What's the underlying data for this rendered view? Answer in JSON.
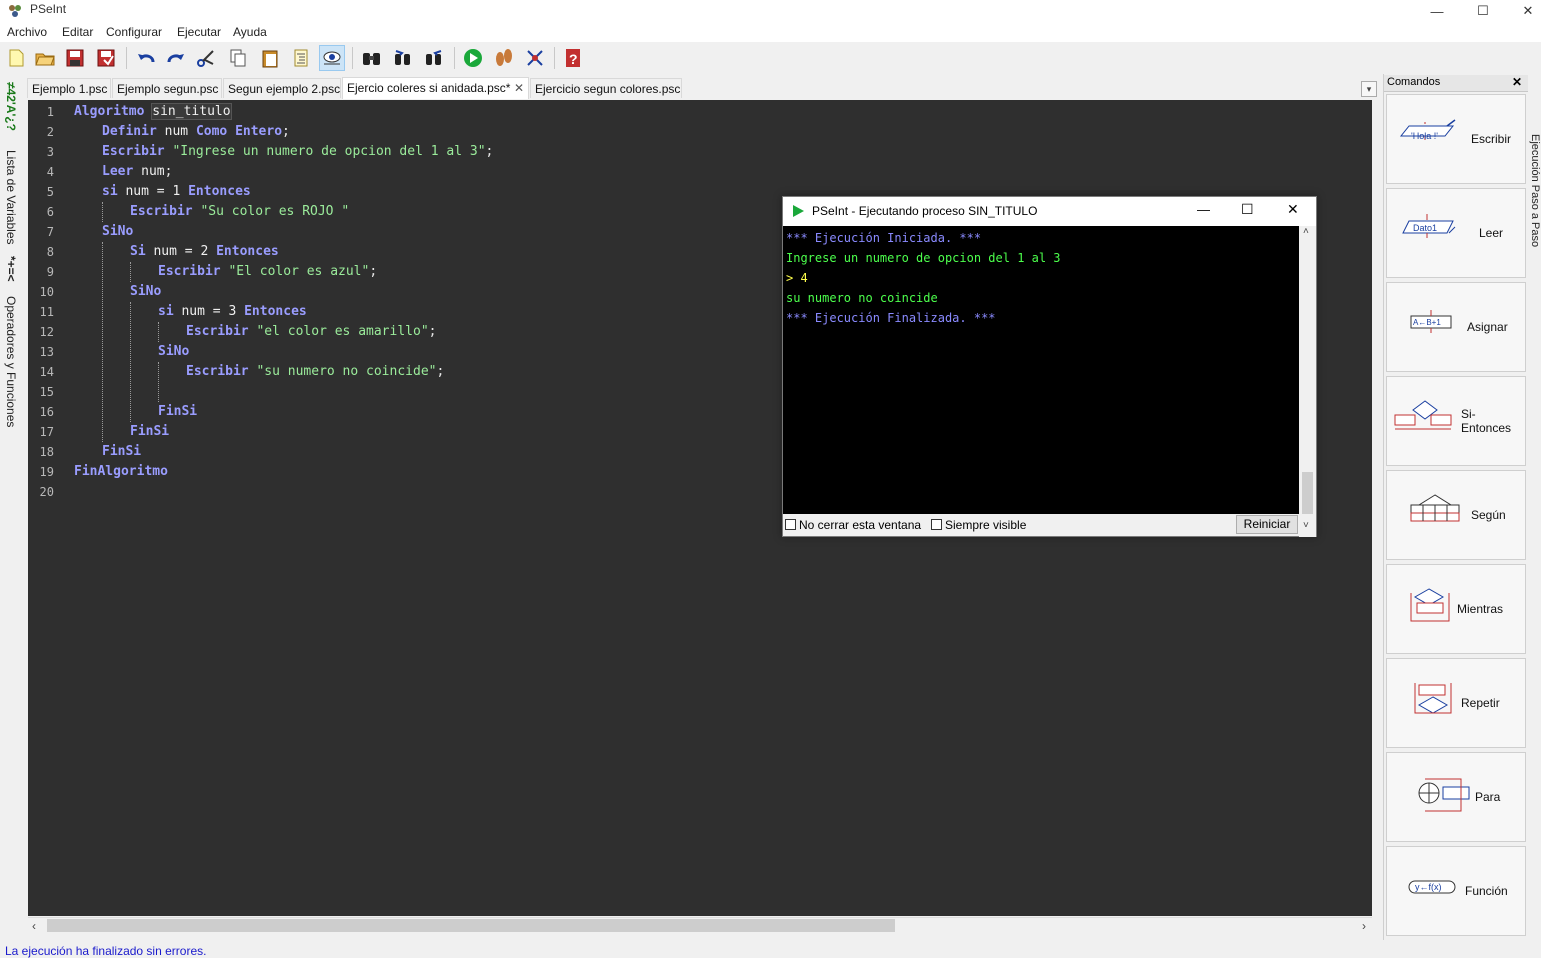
{
  "window": {
    "title": "PSeInt",
    "minimize": "—",
    "maximize": "☐",
    "close": "✕"
  },
  "menu": [
    "Archivo",
    "Editar",
    "Configurar",
    "Ejecutar",
    "Ayuda"
  ],
  "toolbar_icons": [
    "new-file-icon",
    "open-folder-icon",
    "save-icon",
    "save-as-icon",
    "undo-icon",
    "redo-icon",
    "cut-icon",
    "copy-icon",
    "paste-icon",
    "indent-icon",
    "variables-eye-icon",
    "find-icon",
    "find-prev-icon",
    "find-next-icon",
    "run-icon",
    "step-by-step-icon",
    "flowchart-icon",
    "help-icon"
  ],
  "left_panel": {
    "variables_label": "Lista de Variables",
    "operators_label": "Operadores y Funciones",
    "variables_glyph": "≠42'A'¿?",
    "operators_glyph": "*+=<"
  },
  "tabs": [
    {
      "label": "Ejemplo 1.psc"
    },
    {
      "label": "Ejemplo segun.psc"
    },
    {
      "label": "Segun ejemplo 2.psc"
    },
    {
      "label": "Ejercio coleres si anidada.psc*",
      "close": "✕"
    },
    {
      "label": "Ejercicio segun colores.psc"
    }
  ],
  "editor": {
    "line_numbers": [
      "1",
      "2",
      "3",
      "4",
      "5",
      "6",
      "7",
      "8",
      "9",
      "10",
      "11",
      "12",
      "13",
      "14",
      "15",
      "16",
      "17",
      "18",
      "19",
      "20"
    ],
    "lines": {
      "l1": {
        "kw": "Algoritmo",
        "id": "sin_titulo"
      },
      "l2": {
        "kw1": "Definir",
        "id": "num",
        "kw2": "Como",
        "kw3": "Entero",
        "end": ";"
      },
      "l3": {
        "kw": "Escribir",
        "str": "\"Ingrese un numero de opcion del 1 al 3\"",
        "end": ";"
      },
      "l4": {
        "kw": "Leer",
        "id": "num",
        "end": ";"
      },
      "l5": {
        "kw1": "si",
        "id": "num = 1",
        "kw2": "Entonces"
      },
      "l6": {
        "kw": "Escribir",
        "str": "\"Su color es ROJO \""
      },
      "l7": {
        "kw": "SiNo"
      },
      "l8": {
        "kw1": "Si",
        "id": "num = 2",
        "kw2": "Entonces"
      },
      "l9": {
        "kw": "Escribir",
        "str": "\"El color es azul\"",
        "end": ";"
      },
      "l10": {
        "kw": "SiNo"
      },
      "l11": {
        "kw1": "si",
        "id": "num = 3",
        "kw2": "Entonces"
      },
      "l12": {
        "kw": "Escribir",
        "str": "\"el color es amarillo\"",
        "end": ";"
      },
      "l13": {
        "kw": "SiNo"
      },
      "l14": {
        "kw": "Escribir",
        "str": "\"su numero no coincide\"",
        "end": ";"
      },
      "l16": {
        "kw": "FinSi"
      },
      "l17": {
        "kw": "FinSi"
      },
      "l18": {
        "kw": "FinSi"
      },
      "l19": {
        "kw": "FinAlgoritmo"
      }
    }
  },
  "status": "La ejecución ha finalizado sin errores.",
  "commands": {
    "header": "Comandos",
    "close": "✕",
    "items": [
      {
        "label": "Escribir",
        "icon_text": "'Hola !'"
      },
      {
        "label": "Leer",
        "icon_text": "Dato1"
      },
      {
        "label": "Asignar",
        "icon_text": "A←B+1"
      },
      {
        "label": "Si-Entonces",
        "icon_text": ""
      },
      {
        "label": "Según",
        "icon_text": ""
      },
      {
        "label": "Mientras",
        "icon_text": ""
      },
      {
        "label": "Repetir",
        "icon_text": ""
      },
      {
        "label": "Para",
        "icon_text": ""
      },
      {
        "label": "Función",
        "icon_text": "y←f(x)"
      }
    ]
  },
  "right_vertical_label": "Ejecución Paso a Paso",
  "console": {
    "title": "PSeInt - Ejecutando proceso SIN_TITULO",
    "lines": [
      {
        "text": "*** Ejecución Iniciada. ***",
        "color": "#8a8aff"
      },
      {
        "text": "Ingrese un numero de opcion del 1 al 3",
        "color": "#4cff4c"
      },
      {
        "text": "> 4",
        "color": "#ffff4c"
      },
      {
        "text": "su numero no coincide",
        "color": "#4cff4c"
      },
      {
        "text": "*** Ejecución Finalizada. ***",
        "color": "#8a8aff"
      }
    ],
    "no_cerrar": "No cerrar esta ventana",
    "siempre_visible": "Siempre visible",
    "reiniciar": "Reiniciar"
  }
}
